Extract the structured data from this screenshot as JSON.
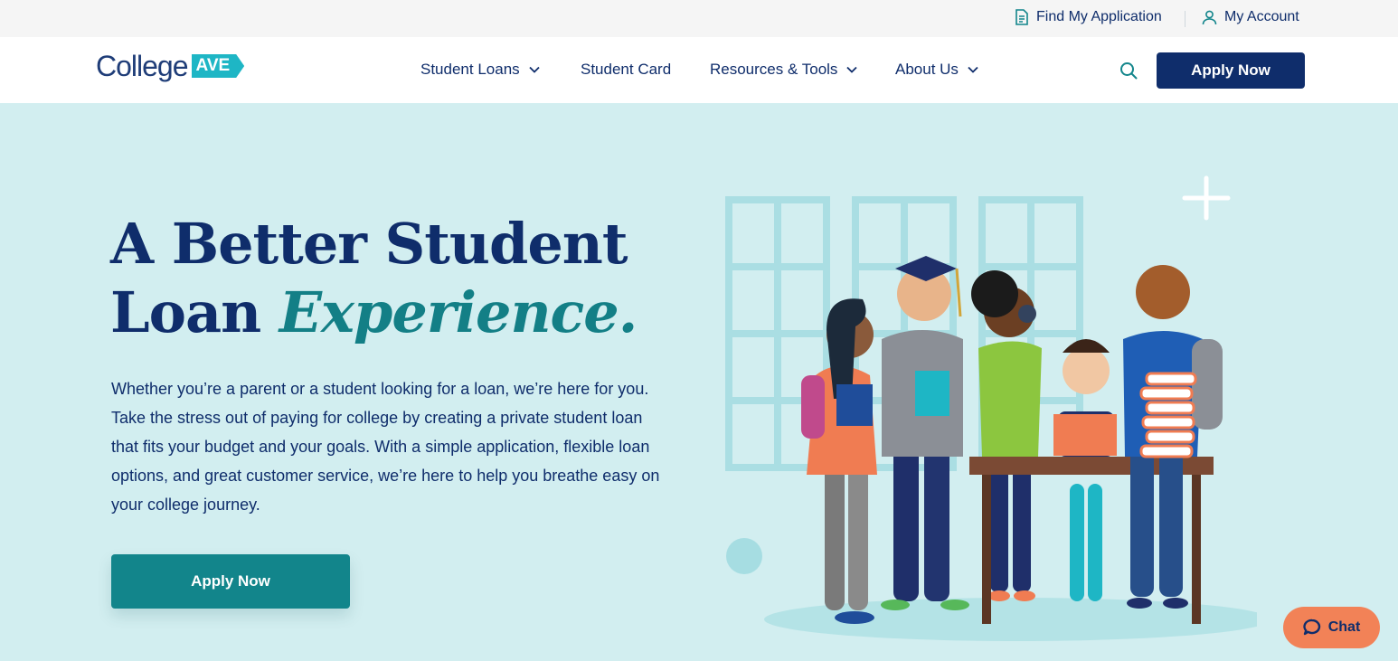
{
  "utility": {
    "find_application": "Find My Application",
    "my_account": "My Account"
  },
  "brand": {
    "logo_word": "College",
    "logo_badge": "AVE",
    "logo_reg": "®"
  },
  "nav": {
    "items": [
      {
        "label": "Student Loans",
        "has_dropdown": true
      },
      {
        "label": "Student Card",
        "has_dropdown": false
      },
      {
        "label": "Resources & Tools",
        "has_dropdown": true
      },
      {
        "label": "About Us",
        "has_dropdown": true
      }
    ],
    "apply_label": "Apply Now"
  },
  "hero": {
    "title_line1": "A Better Student",
    "title_line2_plain": "Loan ",
    "title_line2_accent": "Experience.",
    "body": "Whether you’re a parent or a student looking for a loan, we’re here for you. Take the stress out of paying for college by creating a private student loan that fits your budget and your goals. With a simple application, flexible loan options, and great customer service, we’re here to help you breathe easy on your college journey.",
    "apply_label": "Apply Now"
  },
  "chat": {
    "label": "Chat"
  },
  "colors": {
    "navy": "#0f2d6b",
    "teal": "#12858b",
    "hero_bg": "#d2eef0",
    "chat": "#f28257",
    "logo_badge": "#1eb6c5"
  },
  "icons": [
    "document-icon",
    "user-icon",
    "chevron-down-icon",
    "search-icon",
    "chat-bubble-icon"
  ]
}
